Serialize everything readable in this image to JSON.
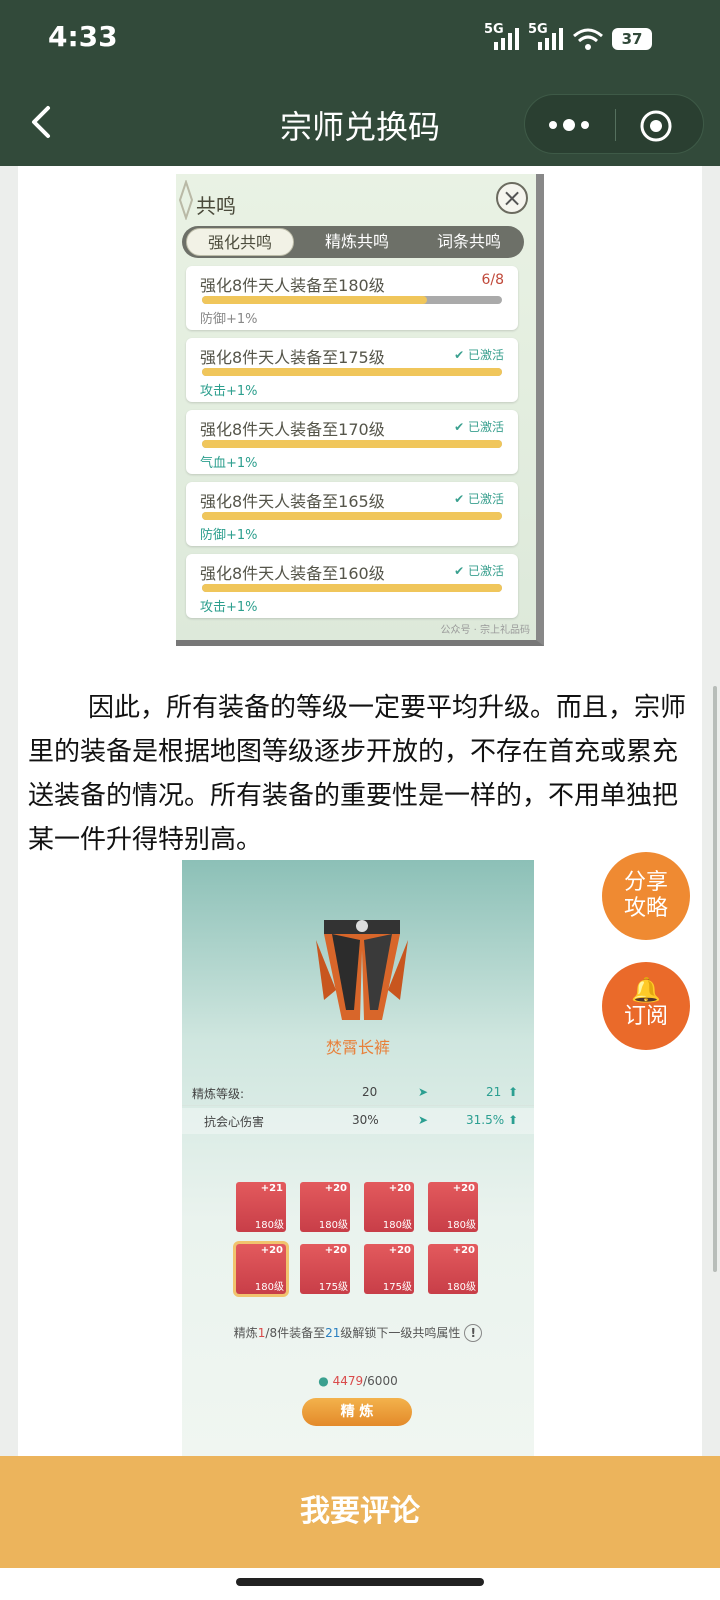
{
  "status_bar": {
    "time": "4:33",
    "signal1": "5G",
    "signal2": "5G",
    "battery": "37"
  },
  "nav": {
    "title": "宗师兑换码"
  },
  "resonance_card": {
    "header": "共鸣",
    "tabs": [
      "强化共鸣",
      "精炼共鸣",
      "词条共鸣"
    ],
    "rows": [
      {
        "title": "强化8件天人装备至180级",
        "status": "6/8",
        "progress": 0.75,
        "effect": "防御+1%",
        "activated": false
      },
      {
        "title": "强化8件天人装备至175级",
        "status": "已激活",
        "progress": 1.0,
        "effect": "攻击+1%",
        "activated": true
      },
      {
        "title": "强化8件天人装备至170级",
        "status": "已激活",
        "progress": 1.0,
        "effect": "气血+1%",
        "activated": true
      },
      {
        "title": "强化8件天人装备至165级",
        "status": "已激活",
        "progress": 1.0,
        "effect": "防御+1%",
        "activated": true
      },
      {
        "title": "强化8件天人装备至160级",
        "status": "已激活",
        "progress": 1.0,
        "effect": "攻击+1%",
        "activated": true
      }
    ],
    "watermark": "公众号 · 宗上礼品码"
  },
  "article": {
    "paragraph": "因此，所有装备的等级一定要平均升级。而且，宗师里的装备是根据地图等级逐步开放的，不存在首充或累充送装备的情况。所有装备的重要性是一样的，不用单独把某一件升得特别高。"
  },
  "refine_card": {
    "item_name": "焚霄长裤",
    "stats": [
      {
        "label": "精炼等级:",
        "from": "20",
        "to": "21"
      },
      {
        "label": "抗会心伤害",
        "from": "30%",
        "to": "31.5%"
      }
    ],
    "slots": [
      {
        "plus": "+21",
        "level": "180级"
      },
      {
        "plus": "+20",
        "level": "180级"
      },
      {
        "plus": "+20",
        "level": "180级"
      },
      {
        "plus": "+20",
        "level": "180级"
      },
      {
        "plus": "+20",
        "level": "180级"
      },
      {
        "plus": "+20",
        "level": "175级"
      },
      {
        "plus": "+20",
        "level": "175级"
      },
      {
        "plus": "+20",
        "level": "180级"
      }
    ],
    "unlock_pre": "精炼",
    "unlock_count": "1",
    "unlock_total": "/8",
    "unlock_mid": "件装备至",
    "unlock_level": "21",
    "unlock_post": "级解锁下一级共鸣属性",
    "resource_have": "4479",
    "resource_need": "/6000",
    "refine_button": "精 炼"
  },
  "fabs": {
    "share": "分享攻略",
    "share_line1": "分享",
    "share_line2": "攻略",
    "subscribe": "订阅"
  },
  "footer": {
    "comment_button": "我要评论"
  }
}
